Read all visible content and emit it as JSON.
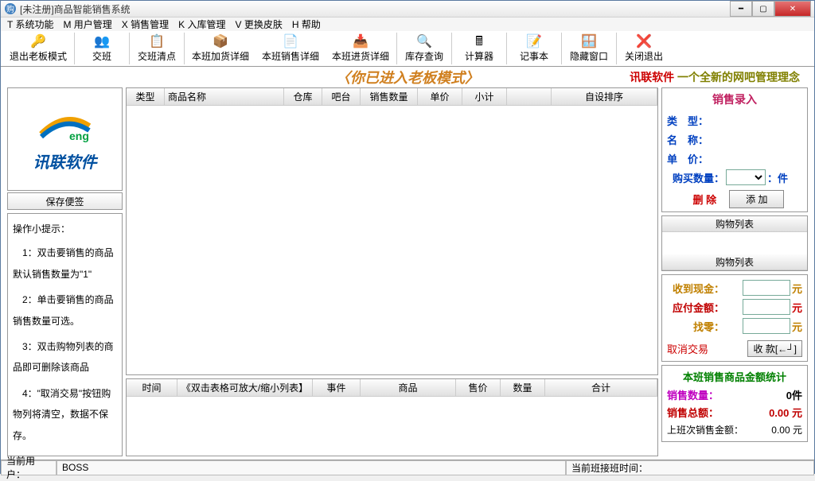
{
  "title": "[未注册]商品智能销售系统",
  "menu": [
    "T 系统功能",
    "M 用户管理",
    "X 销售管理",
    "K 入库管理",
    "V 更换皮肤",
    "H 帮助"
  ],
  "toolbar": [
    {
      "label": "退出老板模式",
      "icon": "🔑"
    },
    {
      "label": "交班",
      "icon": "👥"
    },
    {
      "label": "交班清点",
      "icon": "📋"
    },
    {
      "label": "本班加货详细",
      "icon": "📦"
    },
    {
      "label": "本班销售详细",
      "icon": "📄"
    },
    {
      "label": "本班进货详细",
      "icon": "📥"
    },
    {
      "label": "库存查询",
      "icon": "🔍"
    },
    {
      "label": "计算器",
      "icon": "🖩"
    },
    {
      "label": "记事本",
      "icon": "📝"
    },
    {
      "label": "隐藏窗口",
      "icon": "🪟"
    },
    {
      "label": "关闭退出",
      "icon": "❌"
    }
  ],
  "banner": {
    "center": "〈你已进入老板模式〉",
    "right_a": "讯联软件",
    "right_b": " 一个全新的网吧管理理念"
  },
  "logo": {
    "name": "X eng",
    "text": "讯联软件"
  },
  "save_note": "保存便签",
  "tips": {
    "header": "操作小提示：",
    "items": [
      "1：双击要销售的商品默认销售数量为\"1\"",
      "2：单击要销售的商品销售数量可选。",
      "3：双击购物列表的商品即可删除该商品",
      "4：\"取消交易\"按钮购物列将清空，数据不保存。"
    ]
  },
  "table1_cols": [
    "类型",
    "商品名称",
    "仓库",
    "吧台",
    "销售数量",
    "单价",
    "小计",
    "自设排序"
  ],
  "table2_cols": [
    "时间",
    "《双击表格可放大/缩小列表】",
    "事件",
    "商品",
    "售价",
    "数量",
    "合计"
  ],
  "entry": {
    "title": "销售录入",
    "type_lbl": "类　型：",
    "name_lbl": "名　称：",
    "price_lbl": "单　价：",
    "qty_lbl": "购买数量：",
    "qty_unit": "：件",
    "del": "删 除",
    "add": "添  加"
  },
  "cart_h": "购物列表",
  "pay": {
    "cash_lbl": "收到现金：",
    "cash_unit": "元",
    "due_lbl": "应付金额：",
    "due_unit": "元",
    "change_lbl": "找零：",
    "change_unit": "元",
    "cancel": "取消交易",
    "confirm": "收 款[←┘]"
  },
  "stats": {
    "title": "本班销售商品金额统计",
    "qty_lbl": "销售数量：",
    "qty_val": "0件",
    "total_lbl": "销售总额：",
    "total_val": "0.00 元",
    "last_lbl": "上班次销售金额：",
    "last_val": "0.00 元"
  },
  "status": {
    "user_lbl": "当前用户：",
    "user_val": "BOSS",
    "shift_lbl": "当前班接班时间："
  }
}
